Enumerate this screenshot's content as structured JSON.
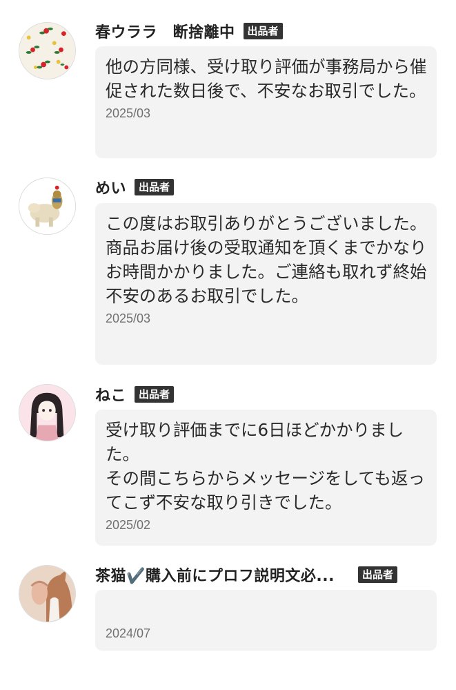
{
  "top_cutoff_text": "〜〜〜〜〜〜〜〜〜〜〜〜",
  "seller_badge": "出品者",
  "reviews": [
    {
      "name": "春ウララ　断捨離中",
      "badge": "出品者",
      "comment": "他の方同様、受け取り評価が事務局から催促された数日後で、不安なお取引でした。",
      "date": "2025/03",
      "avatar_icon": "flower-pattern-avatar-icon"
    },
    {
      "name": "めい",
      "badge": "出品者",
      "comment": "この度はお取引ありがとうございました。\n商品お届け後の受取通知を頂くまでかなりお時間かかりました。ご連絡も取れず終始不安のあるお取引でした。",
      "date": "2025/03",
      "avatar_icon": "figurine-avatar-icon"
    },
    {
      "name": "ねこ",
      "badge": "出品者",
      "comment": "受け取り評価までに6日ほどかかりました。\nその間こちらからメッセージをしても返ってこず不安な取り引きでした。",
      "date": "2025/02",
      "avatar_icon": "anime-girl-avatar-icon"
    },
    {
      "name": "茶猫✔️購入前にプロフ説明文必...",
      "badge": "出品者",
      "comment": "",
      "date": "2024/07",
      "avatar_icon": "cat-avatar-icon"
    }
  ]
}
